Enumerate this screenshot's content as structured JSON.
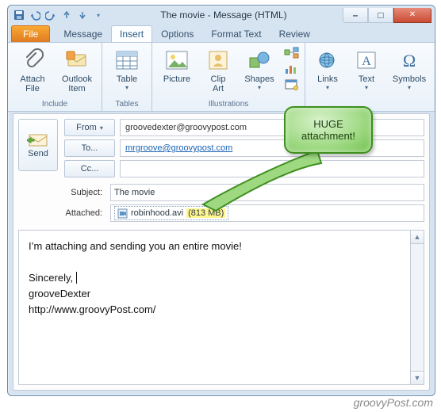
{
  "window": {
    "title": "The movie  -  Message (HTML)"
  },
  "qat": {
    "icons": [
      "save-icon",
      "undo-icon",
      "redo-icon",
      "prev-icon",
      "next-icon",
      "qat-dd-icon"
    ]
  },
  "winbuttons": {
    "min": "–",
    "max": "□",
    "close": "✕"
  },
  "tabs": {
    "file": "File",
    "items": [
      "Message",
      "Insert",
      "Options",
      "Format Text",
      "Review"
    ],
    "active_index": 1
  },
  "ribbon": {
    "groups": [
      {
        "label": "Include",
        "buttons": [
          {
            "name": "attach-file",
            "label": "Attach\nFile",
            "icon": "paperclip-icon"
          },
          {
            "name": "outlook-item",
            "label": "Outlook\nItem",
            "icon": "outlook-item-icon"
          }
        ]
      },
      {
        "label": "Tables",
        "buttons": [
          {
            "name": "table",
            "label": "Table",
            "icon": "table-icon",
            "dropdown": true
          }
        ]
      },
      {
        "label": "Illustrations",
        "buttons": [
          {
            "name": "picture",
            "label": "Picture",
            "icon": "picture-icon"
          },
          {
            "name": "clipart",
            "label": "Clip\nArt",
            "icon": "clipart-icon"
          },
          {
            "name": "shapes",
            "label": "Shapes",
            "icon": "shapes-icon",
            "dropdown": true
          },
          {
            "name": "smartart",
            "label": "",
            "icon": "smartart-icon",
            "small": true
          },
          {
            "name": "chart",
            "label": "",
            "icon": "chart-icon",
            "small": true
          },
          {
            "name": "screenshot",
            "label": "",
            "icon": "screenshot-icon",
            "small": true
          }
        ]
      },
      {
        "label": "",
        "buttons": [
          {
            "name": "links",
            "label": "Links",
            "icon": "links-icon",
            "dropdown": true
          },
          {
            "name": "text",
            "label": "Text",
            "icon": "text-icon",
            "dropdown": true
          },
          {
            "name": "symbols",
            "label": "Symbols",
            "icon": "symbols-icon",
            "dropdown": true
          }
        ]
      }
    ]
  },
  "compose": {
    "send_label": "Send",
    "from_label": "From",
    "from_value": "groovedexter@groovypost.com",
    "to_label": "To...",
    "to_value": "mrgroove@groovypost.com",
    "cc_label": "Cc...",
    "cc_value": "",
    "subject_label": "Subject:",
    "subject_value": "The movie",
    "attached_label": "Attached:",
    "attachment_name": "robinhood.avi",
    "attachment_size": "(813 MB)"
  },
  "body": {
    "line1": "I’m attaching and sending you an entire movie!",
    "sig1": "Sincerely,",
    "sig2": "grooveDexter",
    "sig3": "http://www.groovyPost.com/"
  },
  "callout": {
    "line1": "HUGE",
    "line2": "attachment!"
  },
  "watermark": "groovyPost.com"
}
